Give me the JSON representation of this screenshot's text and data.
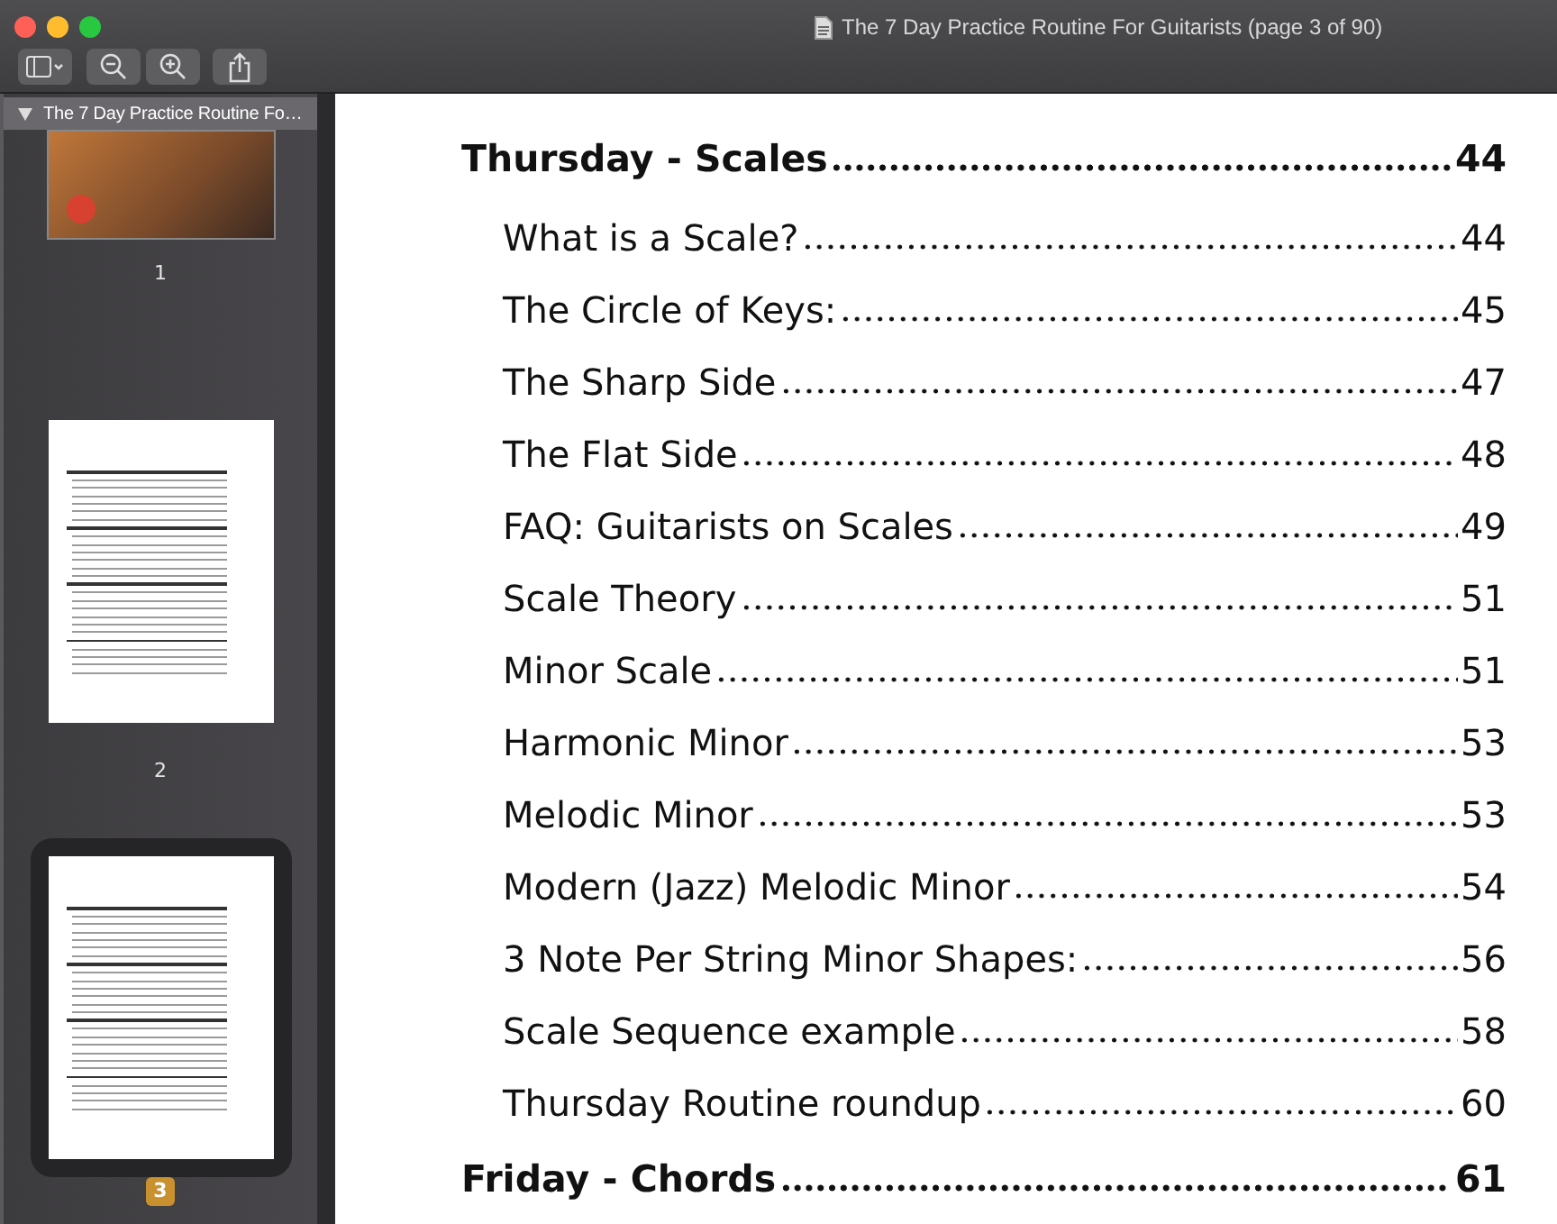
{
  "window": {
    "title": "The 7 Day Practice Routine For Guitarists (page 3 of 90)"
  },
  "sidebar": {
    "header": "The 7 Day Practice Routine Fo…",
    "expanded": true,
    "thumbnails": [
      {
        "label": "1",
        "kind": "cover",
        "selected": false
      },
      {
        "label": "2",
        "kind": "contents",
        "selected": false
      },
      {
        "label": "3",
        "kind": "contents",
        "selected": true
      }
    ]
  },
  "contents": [
    {
      "kind": "section",
      "title": "Thursday - Scales",
      "page": "44"
    },
    {
      "kind": "item",
      "title": "What is a Scale?",
      "page": "44"
    },
    {
      "kind": "item",
      "title": "The Circle of Keys:",
      "page": "45"
    },
    {
      "kind": "item",
      "title": "The Sharp Side",
      "page": "47"
    },
    {
      "kind": "item",
      "title": "The Flat Side",
      "page": "48"
    },
    {
      "kind": "item",
      "title": "FAQ: Guitarists on Scales",
      "page": "49"
    },
    {
      "kind": "item",
      "title": "Scale Theory",
      "page": "51"
    },
    {
      "kind": "item",
      "title": "Minor Scale",
      "page": "51"
    },
    {
      "kind": "item",
      "title": "Harmonic Minor",
      "page": "53"
    },
    {
      "kind": "item",
      "title": "Melodic Minor",
      "page": "53"
    },
    {
      "kind": "item",
      "title": "Modern (Jazz) Melodic Minor",
      "page": "54"
    },
    {
      "kind": "item",
      "title": "3 Note Per String Minor Shapes:",
      "page": "56"
    },
    {
      "kind": "item",
      "title": "Scale Sequence example",
      "page": "58"
    },
    {
      "kind": "item",
      "title": "Thursday Routine roundup",
      "page": "60"
    },
    {
      "kind": "section",
      "title": "Friday - Chords",
      "page": "61"
    }
  ]
}
